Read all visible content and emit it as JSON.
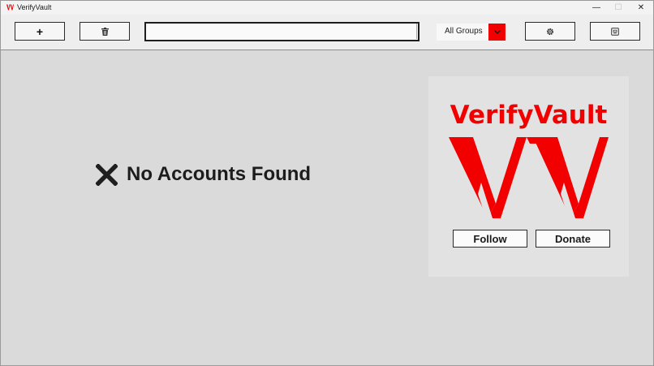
{
  "window": {
    "title": "VerifyVault",
    "minimize_glyph": "—",
    "maximize_glyph": "☐",
    "close_glyph": "✕"
  },
  "toolbar": {
    "add_label": "+",
    "delete_icon": "trash-icon",
    "search_value": "",
    "group_selected": "All Groups",
    "settings_icon": "gear-icon",
    "export_icon": "export-icon"
  },
  "main": {
    "empty_message": "No Accounts Found",
    "empty_icon": "x-icon"
  },
  "brand": {
    "name": "VerifyVault",
    "follow_label": "Follow",
    "donate_label": "Donate"
  },
  "colors": {
    "accent": "#f20000",
    "background": "#dadada",
    "toolbar": "#eeeeee",
    "panel": "#e2e2e2"
  }
}
